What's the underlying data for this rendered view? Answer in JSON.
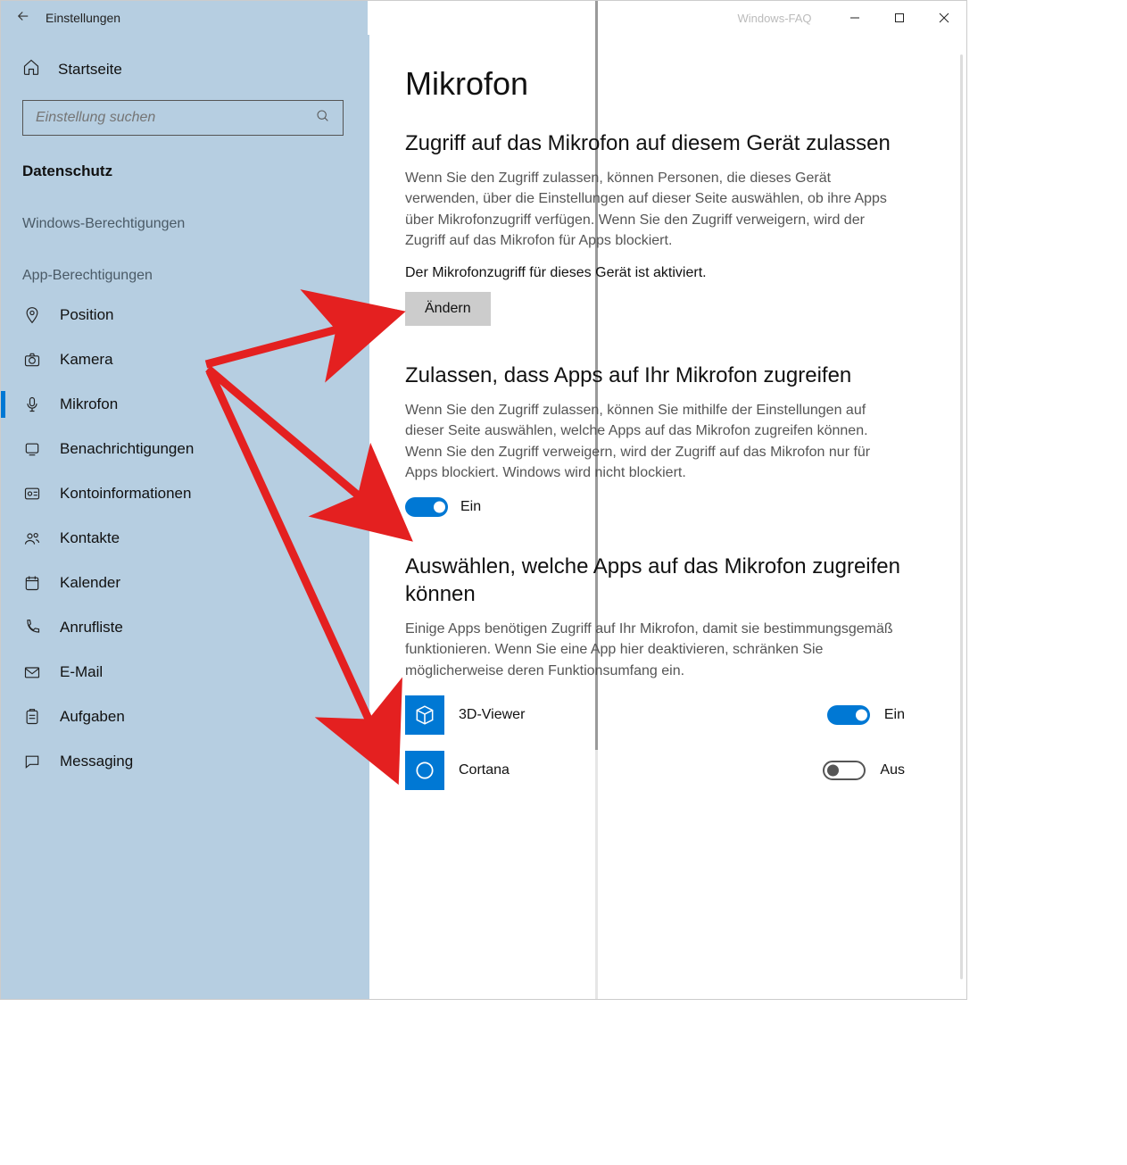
{
  "window": {
    "title": "Einstellungen",
    "watermark": "Windows-FAQ"
  },
  "sidebar": {
    "home": "Startseite",
    "search_placeholder": "Einstellung suchen",
    "category": "Datenschutz",
    "group1_title": "Windows-Berechtigungen",
    "group2_title": "App-Berechtigungen",
    "items": [
      {
        "label": "Position"
      },
      {
        "label": "Kamera"
      },
      {
        "label": "Mikrofon"
      },
      {
        "label": "Benachrichtigungen"
      },
      {
        "label": "Kontoinformationen"
      },
      {
        "label": "Kontakte"
      },
      {
        "label": "Kalender"
      },
      {
        "label": "Anrufliste"
      },
      {
        "label": "E-Mail"
      },
      {
        "label": "Aufgaben"
      },
      {
        "label": "Messaging"
      }
    ]
  },
  "main": {
    "heading": "Mikrofon",
    "section1": {
      "title": "Zugriff auf das Mikrofon auf diesem Gerät zulassen",
      "body": "Wenn Sie den Zugriff zulassen, können Personen, die dieses Gerät verwenden, über die Einstellungen auf dieser Seite auswählen, ob ihre Apps über Mikrofonzugriff verfügen. Wenn Sie den Zugriff verweigern, wird der Zugriff auf das Mikrofon für Apps blockiert.",
      "status": "Der Mikrofonzugriff für dieses Gerät ist aktiviert.",
      "button": "Ändern"
    },
    "section2": {
      "title": "Zulassen, dass Apps auf Ihr Mikrofon zugreifen",
      "body": "Wenn Sie den Zugriff zulassen, können Sie mithilfe der Einstellungen auf dieser Seite auswählen, welche Apps auf das Mikrofon zugreifen können. Wenn Sie den Zugriff verweigern, wird der Zugriff auf das Mikrofon nur für Apps blockiert. Windows wird nicht blockiert.",
      "toggle_label": "Ein"
    },
    "section3": {
      "title": "Auswählen, welche Apps auf das Mikrofon zugreifen können",
      "body": "Einige Apps benötigen Zugriff auf Ihr Mikrofon, damit sie bestimmungsgemäß funktionieren. Wenn Sie eine App hier deaktivieren, schränken Sie möglicherweise deren Funktionsumfang ein.",
      "apps": [
        {
          "name": "3D-Viewer",
          "state": "Ein",
          "on": true
        },
        {
          "name": "Cortana",
          "state": "Aus",
          "on": false
        }
      ]
    }
  }
}
